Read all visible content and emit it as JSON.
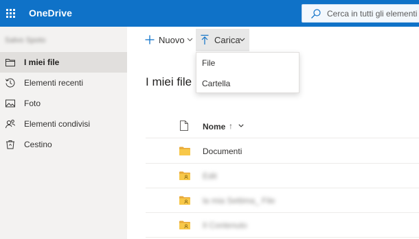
{
  "header": {
    "app_title": "OneDrive",
    "search_placeholder": "Cerca in tutti gli elementi",
    "brand_color": "#0f72c8"
  },
  "sidebar": {
    "user_name": "Salvo Spoto",
    "items": [
      {
        "label": "I miei file",
        "icon": "folder-icon",
        "active": true
      },
      {
        "label": "Elementi recenti",
        "icon": "history-clock-icon",
        "active": false
      },
      {
        "label": "Foto",
        "icon": "photo-icon",
        "active": false
      },
      {
        "label": "Elementi condivisi",
        "icon": "shared-people-icon",
        "active": false
      },
      {
        "label": "Cestino",
        "icon": "recycle-bin-icon",
        "active": false
      }
    ]
  },
  "commandbar": {
    "new_label": "Nuovo",
    "upload_label": "Carica"
  },
  "upload_menu": {
    "items": [
      "File",
      "Cartella"
    ]
  },
  "main": {
    "title": "I miei file",
    "column_name": "Nome",
    "sort_indicator": "↑",
    "rows": [
      {
        "name": "Documenti",
        "shared": false,
        "blurred": false
      },
      {
        "name": "Edit",
        "shared": true,
        "blurred": true
      },
      {
        "name": "la mia Settima_ File",
        "shared": true,
        "blurred": true
      },
      {
        "name": "Il Contenuto",
        "shared": true,
        "blurred": true
      }
    ]
  }
}
